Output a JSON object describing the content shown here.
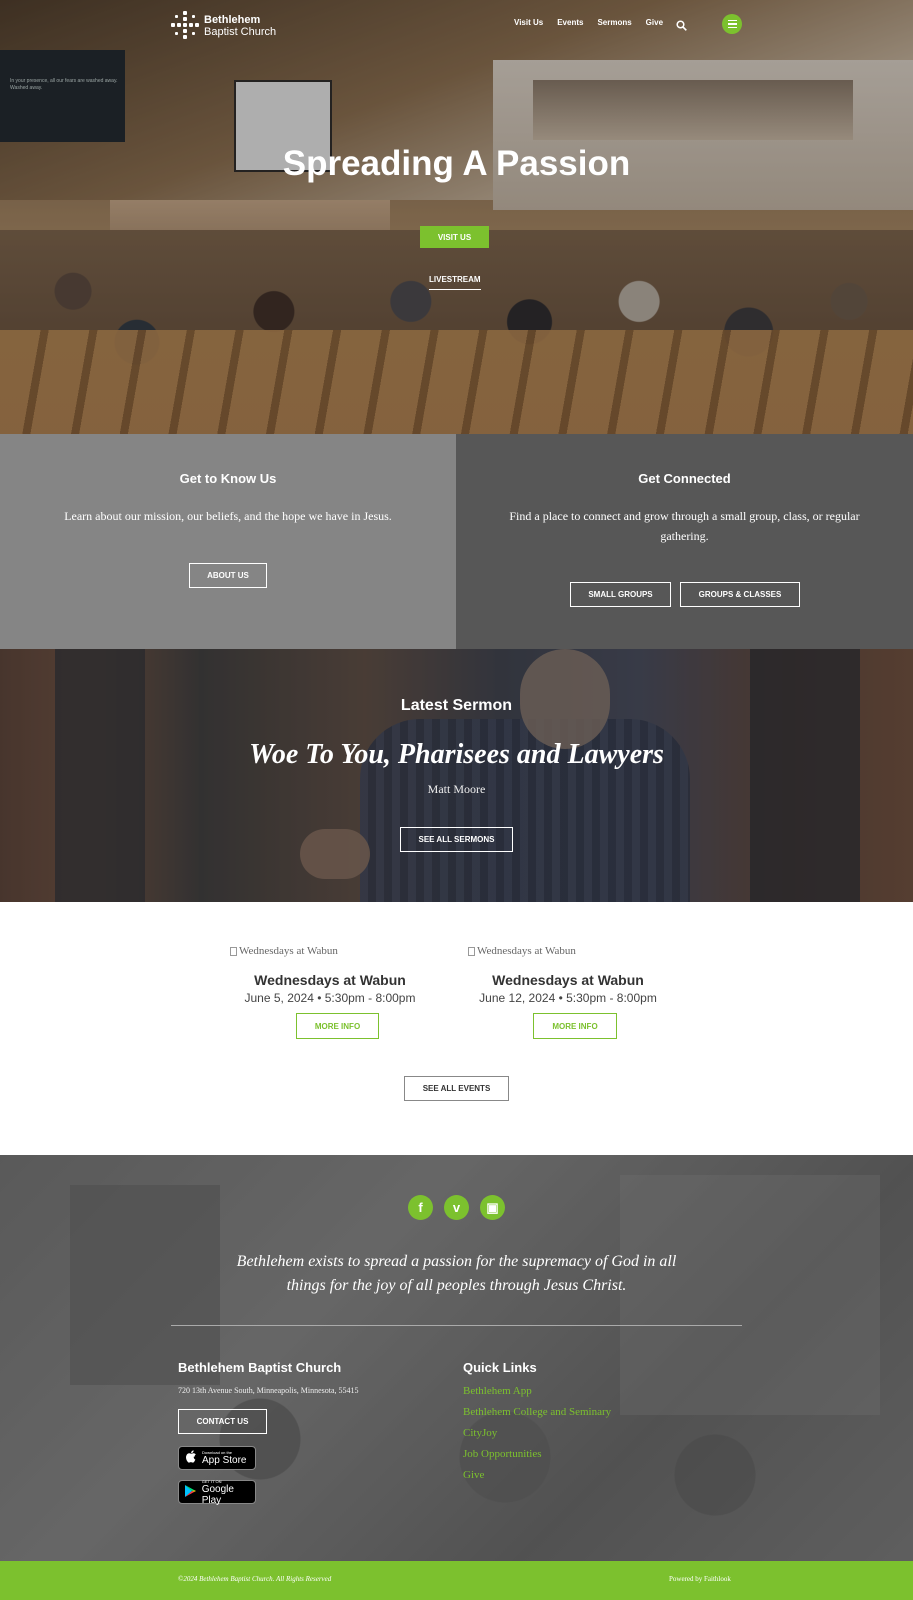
{
  "brand": {
    "line1": "Bethlehem",
    "line2": "Baptist Church",
    "accent_color": "#7cc12e"
  },
  "nav": {
    "items": [
      "Visit Us",
      "Events",
      "Sermons",
      "Give"
    ],
    "search_icon": "search-icon",
    "menu_icon": "hamburger-icon"
  },
  "hero": {
    "screen_text": "In your presence, all our fears are washed away. Washed away.",
    "title": "Spreading A Passion",
    "primary_button": "VISIT US",
    "secondary_link": "LIVESTREAM"
  },
  "panels": {
    "left": {
      "title": "Get to Know Us",
      "text": "Learn about our mission, our beliefs, and the hope we have in Jesus.",
      "button": "ABOUT US"
    },
    "right": {
      "title": "Get Connected",
      "text": "Find a place to connect and grow through a small group, class, or regular gathering.",
      "buttons": [
        "SMALL GROUPS",
        "GROUPS & CLASSES"
      ]
    }
  },
  "sermon": {
    "heading": "Latest Sermon",
    "title": "Woe To You, Pharisees and Lawyers",
    "speaker": "Matt Moore",
    "button": "SEE ALL SERMONS"
  },
  "events": {
    "items": [
      {
        "image_alt": "Wednesdays at Wabun",
        "title": "Wednesdays at Wabun",
        "date": "June 5, 2024 • 5:30pm - 8:00pm",
        "button": "MORE INFO"
      },
      {
        "image_alt": "Wednesdays at Wabun",
        "title": "Wednesdays at Wabun",
        "date": "June 12, 2024 • 5:30pm - 8:00pm",
        "button": "MORE INFO"
      }
    ],
    "all_button": "SEE ALL EVENTS"
  },
  "footer": {
    "social": [
      {
        "icon": "facebook-icon",
        "glyph": "f"
      },
      {
        "icon": "vimeo-icon",
        "glyph": "v"
      },
      {
        "icon": "podcast-icon",
        "glyph": "▣"
      }
    ],
    "mission_line1": "Bethlehem exists to spread a passion for the supremacy of God in all",
    "mission_line2": "things for the joy of all peoples through Jesus Christ.",
    "church_name": "Bethlehem Baptist Church",
    "address": "720 13th Avenue South, Minneapolis, Minnesota, 55415",
    "contact_button": "CONTACT US",
    "app_store": {
      "small": "Download on the",
      "big": "App Store",
      "icon": "apple-icon"
    },
    "google_play": {
      "small": "GET IT ON",
      "big": "Google Play",
      "icon": "google-play-icon"
    },
    "quick_links_title": "Quick Links",
    "quick_links": [
      "Bethlehem App",
      "Bethlehem College and Seminary",
      "CityJoy",
      "Job Opportunities",
      "Give"
    ],
    "copyright": "©2024 Bethlehem Baptist Church. All Rights Reserved",
    "powered_by": "Powered by Faithlook"
  }
}
